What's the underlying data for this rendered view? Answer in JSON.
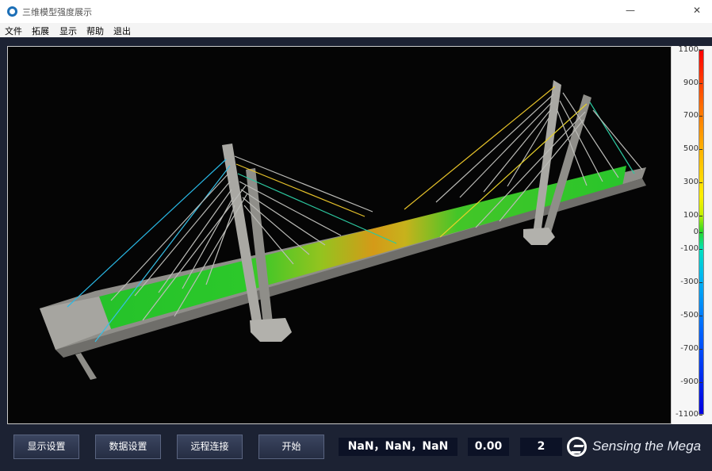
{
  "window": {
    "title": "三维模型强度展示",
    "minimize": "—",
    "close": "✕"
  },
  "menu": [
    "文件",
    "拓展",
    "显示",
    "帮助",
    "退出"
  ],
  "scale": {
    "ticks": [
      "1100",
      "900",
      "700",
      "500",
      "300",
      "100",
      "0",
      "-100",
      "-300",
      "-500",
      "-700",
      "-900",
      "-1100"
    ]
  },
  "buttons": {
    "display_settings": "显示设置",
    "data_settings": "数据设置",
    "remote_connect": "远程连接",
    "start": "开始"
  },
  "readouts": {
    "coords": "NaN，NaN，NaN",
    "value": "0.00",
    "count": "2"
  },
  "logo": {
    "text": "Sensing the Mega"
  },
  "icons": [
    "app-icon",
    "minimize-icon",
    "close-icon",
    "logo-icon"
  ]
}
